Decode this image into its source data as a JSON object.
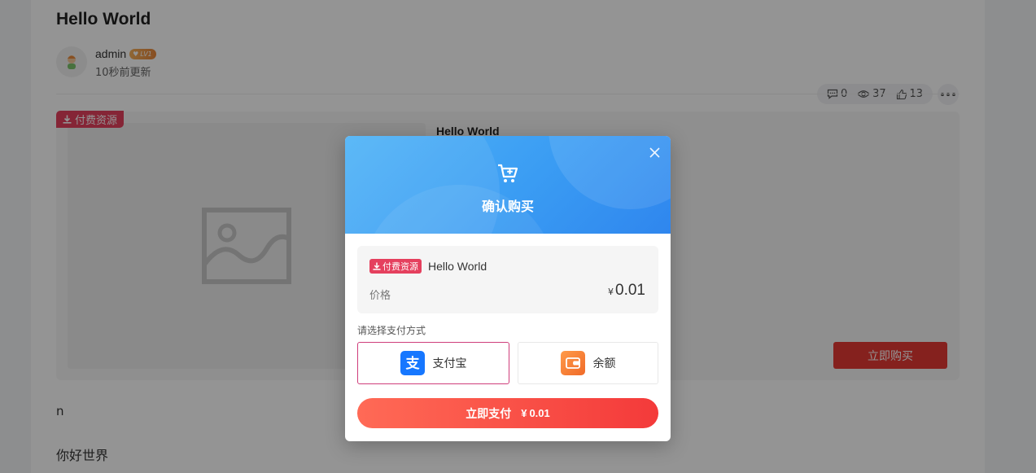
{
  "post": {
    "title": "Hello World",
    "author": "admin",
    "level": "LV1",
    "updated": "10秒前更新",
    "stats": {
      "comments": "0",
      "views": "37",
      "likes": "13"
    },
    "paid_tag": "付费资源",
    "resource_title": "Hello World",
    "buy_button": "立即购买",
    "content": [
      "n",
      "你好世界"
    ]
  },
  "modal": {
    "title": "确认购买",
    "paid_tag": "付费资源",
    "item_title": "Hello World",
    "price_label": "价格",
    "currency": "¥",
    "price": "0.01",
    "method_label": "请选择支付方式",
    "methods": [
      {
        "label": "支付宝",
        "icon": "alipay-icon",
        "selected": true
      },
      {
        "label": "余额",
        "icon": "wallet-icon",
        "selected": false
      }
    ],
    "pay_button": "立即支付",
    "pay_price": "0.01"
  },
  "colors": {
    "accent_blue": "#3a9cf3",
    "paid_tag": "#e5405e",
    "buy_red": "#e53935",
    "pay_gradient_start": "#ff6a56",
    "pay_gradient_end": "#f43a3a",
    "selected_border": "#cf3e7b"
  }
}
